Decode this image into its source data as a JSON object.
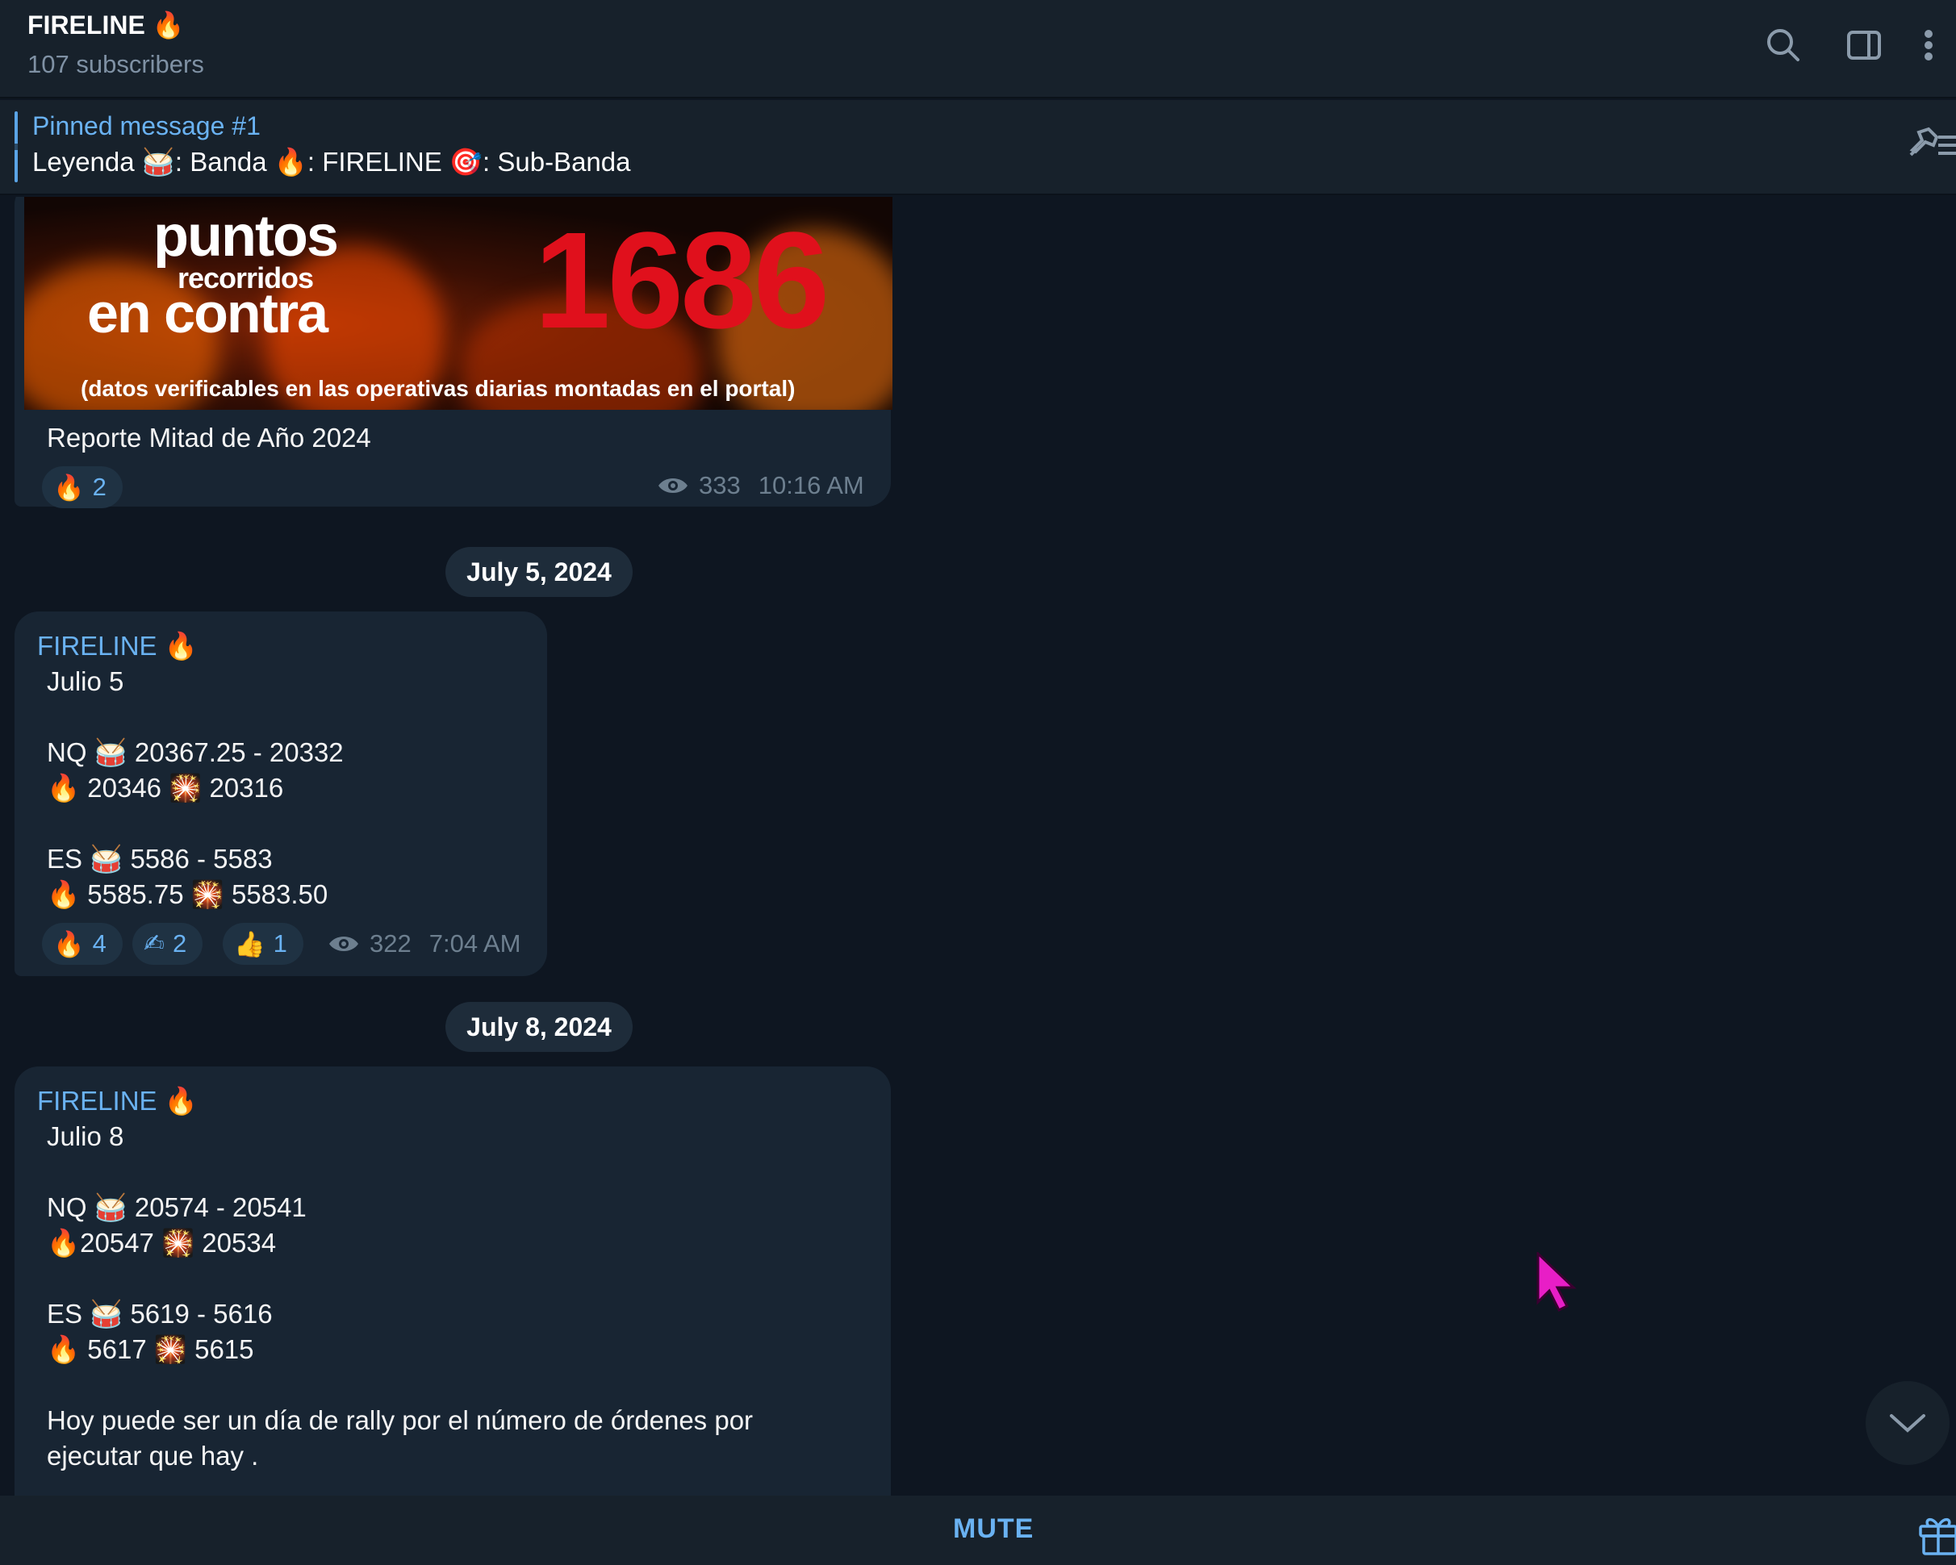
{
  "header": {
    "title": "FIRELINE 🔥",
    "subscribers": "107 subscribers",
    "icons": [
      "search-icon",
      "sidebar-toggle-icon",
      "more-vert-icon"
    ]
  },
  "pinned": {
    "title": "Pinned message #1",
    "text": "Leyenda 🥁: Banda  🔥: FIRELINE  🎯: Sub-Banda"
  },
  "messages": [
    {
      "image": {
        "line1": "puntos",
        "line2": "recorridos",
        "line3": "en contra",
        "number": "1686",
        "footer": "(datos verificables en las operativas diarias montadas en el portal)"
      },
      "caption": "Reporte Mitad de Año 2024",
      "reactions": [
        {
          "emoji": "🔥",
          "count": "2"
        }
      ],
      "views": "333",
      "time": "10:16 AM"
    },
    {
      "date": "July 5, 2024",
      "author": "FIRELINE 🔥",
      "lines": [
        "Julio 5",
        "",
        "NQ 🥁 20367.25 - 20332",
        "      🔥 20346 🎇 20316",
        "",
        "ES 🥁 5586 - 5583",
        "     🔥 5585.75 🎇 5583.50"
      ],
      "reactions": [
        {
          "emoji": "🔥",
          "count": "4"
        },
        {
          "emoji": "✍",
          "count": "2"
        },
        {
          "emoji": "👍",
          "count": "1"
        }
      ],
      "views": "322",
      "time": "7:04 AM"
    },
    {
      "date": "July 8, 2024",
      "author": "FIRELINE 🔥",
      "lines": [
        "Julio 8",
        "",
        "NQ 🥁 20574 - 20541",
        "      🔥20547 🎇 20534",
        "",
        "ES 🥁 5619 - 5616",
        "    🔥 5617 🎇 5615",
        "",
        "Hoy puede ser un día de rally por el número de órdenes por",
        "ejecutar que hay ."
      ]
    }
  ],
  "bottom": {
    "mute_label": "MUTE"
  },
  "colors": {
    "background": "#0e1621",
    "bubble": "#182533",
    "accent": "#6ab2f2",
    "header": "#17212b"
  }
}
